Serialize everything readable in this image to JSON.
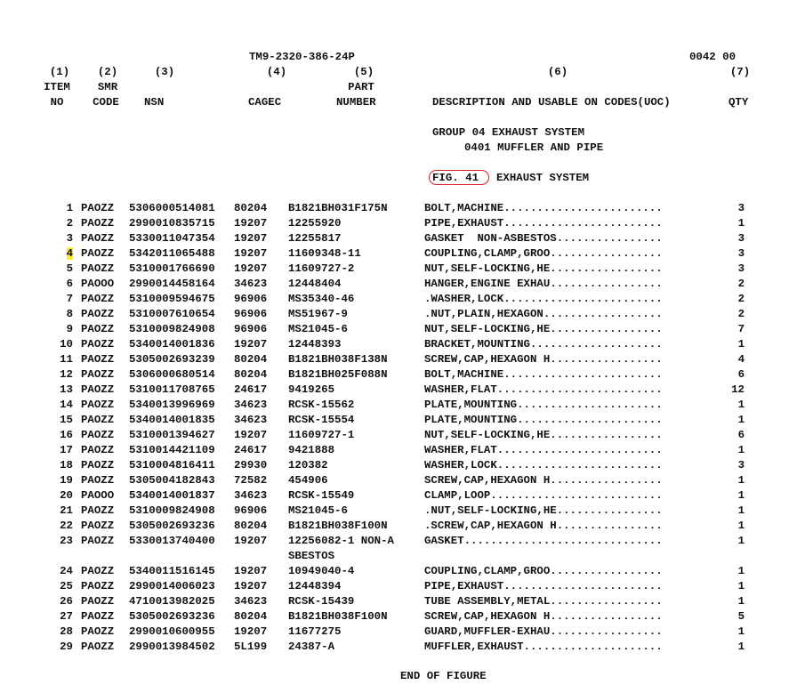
{
  "header": {
    "tm_number": "TM9-2320-386-24P",
    "work_package": "0042 00",
    "col_nums": [
      "(1)",
      "(2)",
      "(3)",
      "(4)",
      "(5)",
      "(6)",
      "(7)"
    ],
    "item_l1": "ITEM",
    "item_l2": "NO",
    "smr_l1": "SMR",
    "smr_l2": "CODE",
    "nsn": "NSN",
    "cagec": "CAGEC",
    "part_l1": "PART",
    "part_l2": "NUMBER",
    "desc": "DESCRIPTION AND USABLE ON CODES(UOC)",
    "qty": "QTY"
  },
  "group": {
    "group_line": "GROUP 04 EXHAUST SYSTEM",
    "subgroup_line": "0401 MUFFLER AND PIPE",
    "figure_label": "FIG. 41",
    "figure_title": "EXHAUST SYSTEM"
  },
  "highlight_color": "#ffef2a",
  "circle_color": "#d81e2a",
  "parts": [
    {
      "item": "1",
      "smr": "PAOZZ",
      "nsn": "5306000514081",
      "cage": "80204",
      "part": "B1821BH031F175N",
      "desc": "BOLT,MACHINE........................",
      "qty": "3"
    },
    {
      "item": "2",
      "smr": "PAOZZ",
      "nsn": "2990010835715",
      "cage": "19207",
      "part": "12255920",
      "desc": "PIPE,EXHAUST........................",
      "qty": "1"
    },
    {
      "item": "3",
      "smr": "PAOZZ",
      "nsn": "5330011047354",
      "cage": "19207",
      "part": "12255817",
      "desc": "GASKET  NON-ASBESTOS................",
      "qty": "3"
    },
    {
      "item": "4",
      "smr": "PAOZZ",
      "nsn": "5342011065488",
      "cage": "19207",
      "part": "11609348-11",
      "desc": "COUPLING,CLAMP,GROO.................",
      "qty": "3",
      "highlight": true
    },
    {
      "item": "5",
      "smr": "PAOZZ",
      "nsn": "5310001766690",
      "cage": "19207",
      "part": "11609727-2",
      "desc": "NUT,SELF-LOCKING,HE.................",
      "qty": "3"
    },
    {
      "item": "6",
      "smr": "PAOOO",
      "nsn": "2990014458164",
      "cage": "34623",
      "part": "12448404",
      "desc": "HANGER,ENGINE EXHAU.................",
      "qty": "2"
    },
    {
      "item": "7",
      "smr": "PAOZZ",
      "nsn": "5310009594675",
      "cage": "96906",
      "part": "MS35340-46",
      "desc": ".WASHER,LOCK........................",
      "qty": "2"
    },
    {
      "item": "8",
      "smr": "PAOZZ",
      "nsn": "5310007610654",
      "cage": "96906",
      "part": "MS51967-9",
      "desc": ".NUT,PLAIN,HEXAGON..................",
      "qty": "2"
    },
    {
      "item": "9",
      "smr": "PAOZZ",
      "nsn": "5310009824908",
      "cage": "96906",
      "part": "MS21045-6",
      "desc": "NUT,SELF-LOCKING,HE.................",
      "qty": "7"
    },
    {
      "item": "10",
      "smr": "PAOZZ",
      "nsn": "5340014001836",
      "cage": "19207",
      "part": "12448393",
      "desc": "BRACKET,MOUNTING....................",
      "qty": "1"
    },
    {
      "item": "11",
      "smr": "PAOZZ",
      "nsn": "5305002693239",
      "cage": "80204",
      "part": "B1821BH038F138N",
      "desc": "SCREW,CAP,HEXAGON H.................",
      "qty": "4"
    },
    {
      "item": "12",
      "smr": "PAOZZ",
      "nsn": "5306000680514",
      "cage": "80204",
      "part": "B1821BH025F088N",
      "desc": "BOLT,MACHINE........................",
      "qty": "6"
    },
    {
      "item": "13",
      "smr": "PAOZZ",
      "nsn": "5310011708765",
      "cage": "24617",
      "part": "9419265",
      "desc": "WASHER,FLAT.........................",
      "qty": "12"
    },
    {
      "item": "14",
      "smr": "PAOZZ",
      "nsn": "5340013996969",
      "cage": "34623",
      "part": "RCSK-15562",
      "desc": "PLATE,MOUNTING......................",
      "qty": "1"
    },
    {
      "item": "15",
      "smr": "PAOZZ",
      "nsn": "5340014001835",
      "cage": "34623",
      "part": "RCSK-15554",
      "desc": "PLATE,MOUNTING......................",
      "qty": "1"
    },
    {
      "item": "16",
      "smr": "PAOZZ",
      "nsn": "5310001394627",
      "cage": "19207",
      "part": "11609727-1",
      "desc": "NUT,SELF-LOCKING,HE.................",
      "qty": "6"
    },
    {
      "item": "17",
      "smr": "PAOZZ",
      "nsn": "5310014421109",
      "cage": "24617",
      "part": "9421888",
      "desc": "WASHER,FLAT.........................",
      "qty": "1"
    },
    {
      "item": "18",
      "smr": "PAOZZ",
      "nsn": "5310004816411",
      "cage": "29930",
      "part": "120382",
      "desc": "WASHER,LOCK.........................",
      "qty": "3"
    },
    {
      "item": "19",
      "smr": "PAOZZ",
      "nsn": "5305004182843",
      "cage": "72582",
      "part": "454906",
      "desc": "SCREW,CAP,HEXAGON H.................",
      "qty": "1"
    },
    {
      "item": "20",
      "smr": "PAOOO",
      "nsn": "5340014001837",
      "cage": "34623",
      "part": "RCSK-15549",
      "desc": "CLAMP,LOOP..........................",
      "qty": "1"
    },
    {
      "item": "21",
      "smr": "PAOZZ",
      "nsn": "5310009824908",
      "cage": "96906",
      "part": "MS21045-6",
      "desc": ".NUT,SELF-LOCKING,HE................",
      "qty": "1"
    },
    {
      "item": "22",
      "smr": "PAOZZ",
      "nsn": "5305002693236",
      "cage": "80204",
      "part": "B1821BH038F100N",
      "desc": ".SCREW,CAP,HEXAGON H................",
      "qty": "1"
    },
    {
      "item": "23",
      "smr": "PAOZZ",
      "nsn": "5330013740400",
      "cage": "19207",
      "part": "12256082-1 NON-A",
      "desc": "GASKET..............................",
      "qty": "1",
      "cont": "SBESTOS"
    },
    {
      "item": "24",
      "smr": "PAOZZ",
      "nsn": "5340011516145",
      "cage": "19207",
      "part": "10949040-4",
      "desc": "COUPLING,CLAMP,GROO.................",
      "qty": "1"
    },
    {
      "item": "25",
      "smr": "PAOZZ",
      "nsn": "2990014006023",
      "cage": "19207",
      "part": "12448394",
      "desc": "PIPE,EXHAUST........................",
      "qty": "1"
    },
    {
      "item": "26",
      "smr": "PAOZZ",
      "nsn": "4710013982025",
      "cage": "34623",
      "part": "RCSK-15439",
      "desc": "TUBE ASSEMBLY,METAL.................",
      "qty": "1"
    },
    {
      "item": "27",
      "smr": "PAOZZ",
      "nsn": "5305002693236",
      "cage": "80204",
      "part": "B1821BH038F100N",
      "desc": "SCREW,CAP,HEXAGON H.................",
      "qty": "5"
    },
    {
      "item": "28",
      "smr": "PAOZZ",
      "nsn": "2990010600955",
      "cage": "19207",
      "part": "11677275",
      "desc": "GUARD,MUFFLER-EXHAU.................",
      "qty": "1"
    },
    {
      "item": "29",
      "smr": "PAOZZ",
      "nsn": "2990013984502",
      "cage": "5L199",
      "part": "24387-A",
      "desc": "MUFFLER,EXHAUST.....................",
      "qty": "1"
    }
  ],
  "footer": "END OF FIGURE"
}
